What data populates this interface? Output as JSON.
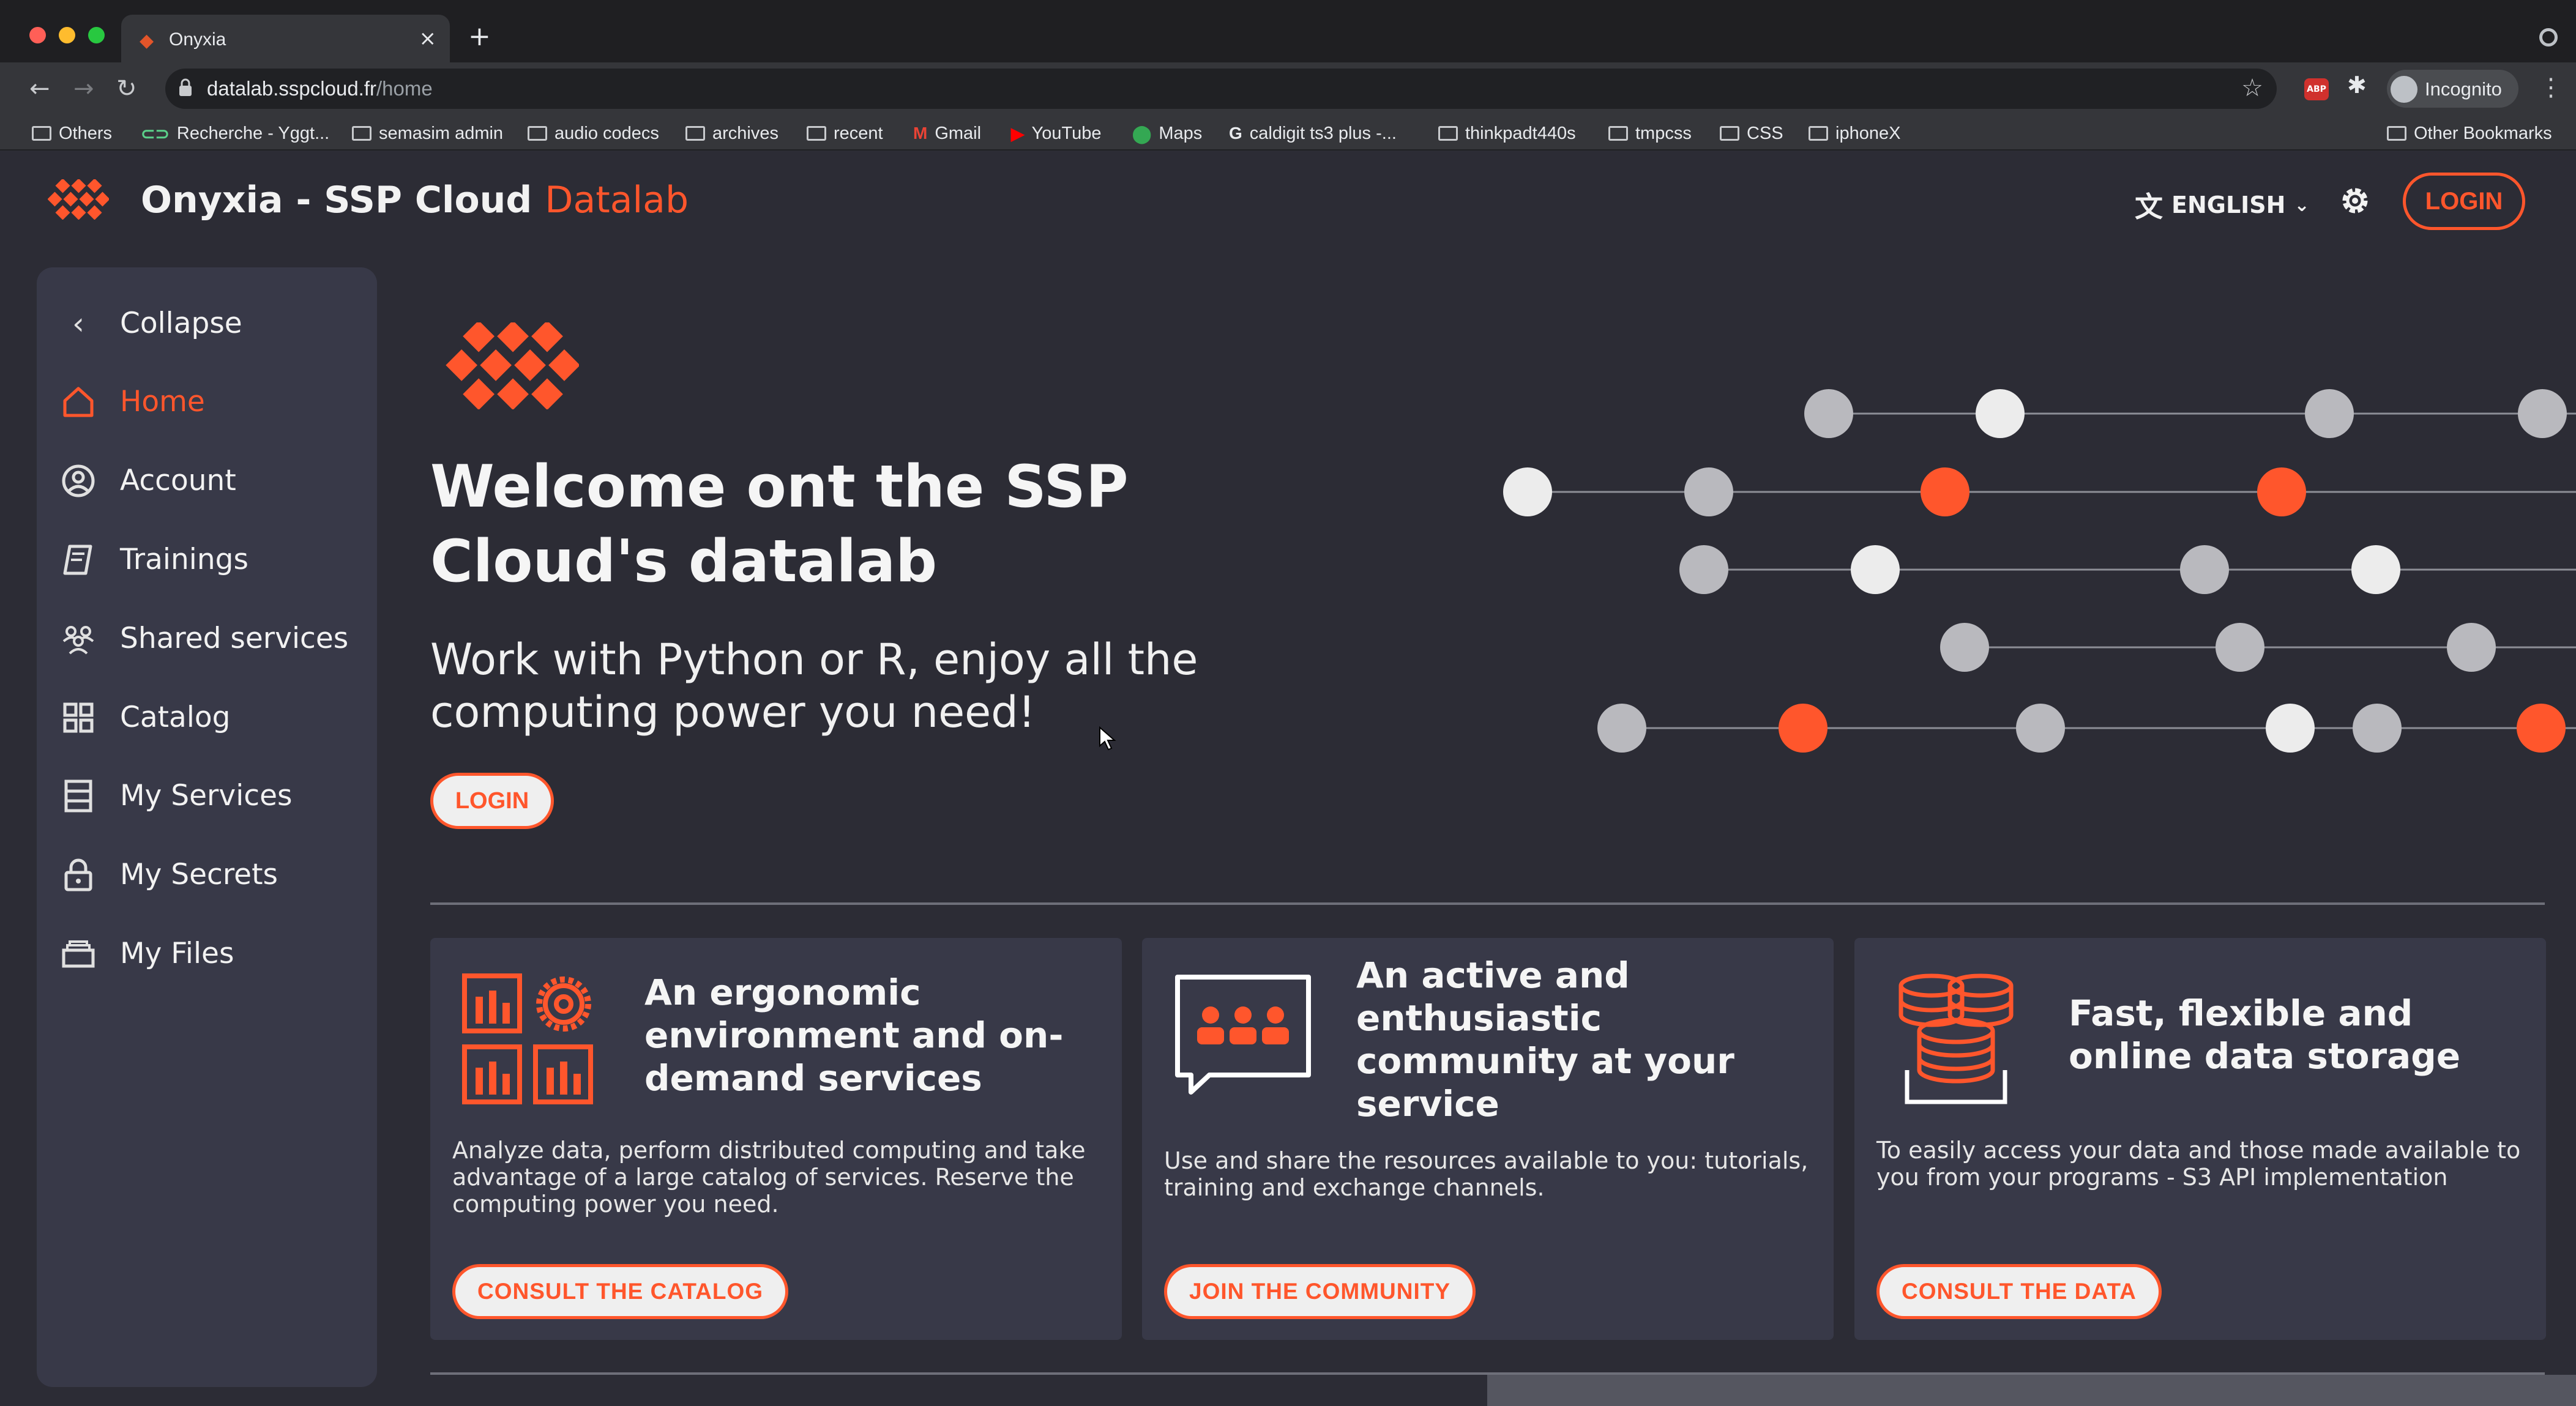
{
  "browser": {
    "tab_title": "Onyxia",
    "tab_close": "×",
    "new_tab": "+",
    "url_host": "datalab.sspcloud.fr",
    "url_path": "/home",
    "profile": "Incognito",
    "bookmarks": [
      {
        "label": "Others",
        "icon": "folder-icon"
      },
      {
        "label": "Recherche - Yggt...",
        "icon": "link-icon"
      },
      {
        "label": "semasim admin",
        "icon": "folder-icon"
      },
      {
        "label": "audio codecs",
        "icon": "folder-icon"
      },
      {
        "label": "archives",
        "icon": "folder-icon"
      },
      {
        "label": "recent",
        "icon": "folder-icon"
      },
      {
        "label": "Gmail",
        "icon": "gmail-icon"
      },
      {
        "label": "YouTube",
        "icon": "youtube-icon"
      },
      {
        "label": "Maps",
        "icon": "maps-icon"
      },
      {
        "label": "caldigit ts3 plus -...",
        "icon": "google-icon"
      },
      {
        "label": "thinkpadt440s",
        "icon": "folder-icon"
      },
      {
        "label": "tmpcss",
        "icon": "folder-icon"
      },
      {
        "label": "CSS",
        "icon": "folder-icon"
      },
      {
        "label": "iphoneX",
        "icon": "folder-icon"
      }
    ],
    "other_bookmarks": "Other Bookmarks"
  },
  "header": {
    "title_main": "Onyxia - SSP Cloud",
    "title_accent": "Datalab",
    "language": "ENGLISH",
    "login": "LOGIN"
  },
  "sidebar": {
    "collapse": "Collapse",
    "items": [
      {
        "label": "Home",
        "icon": "home-icon",
        "active": true
      },
      {
        "label": "Account",
        "icon": "account-icon"
      },
      {
        "label": "Trainings",
        "icon": "trainings-icon"
      },
      {
        "label": "Shared services",
        "icon": "shared-services-icon"
      },
      {
        "label": "Catalog",
        "icon": "catalog-icon"
      },
      {
        "label": "My Services",
        "icon": "services-icon"
      },
      {
        "label": "My Secrets",
        "icon": "lock-icon"
      },
      {
        "label": "My Files",
        "icon": "files-icon"
      }
    ]
  },
  "hero": {
    "title": "Welcome ont the SSP Cloud's datalab",
    "subtitle": "Work with Python or R, enjoy all the computing power you need!",
    "login": "LOGIN"
  },
  "cards": [
    {
      "title": "An ergonomic environment and on-demand services",
      "description": "Analyze data, perform distributed computing and take advantage of a large catalog of services. Reserve the computing power you need.",
      "button": "CONSULT THE CATALOG"
    },
    {
      "title": "An active and enthusiastic community at your service",
      "description": "Use and share the resources available to you: tutorials, training and exchange channels.",
      "button": "JOIN THE COMMUNITY"
    },
    {
      "title": "Fast, flexible and online data storage",
      "description": "To easily access your data and those made available to you from your programs - S3 API implementation",
      "button": "CONSULT THE DATA"
    }
  ],
  "colors": {
    "accent": "#ff562c",
    "background": "#2c2c35",
    "surface": "#383948",
    "text": "#f2f2f2"
  }
}
